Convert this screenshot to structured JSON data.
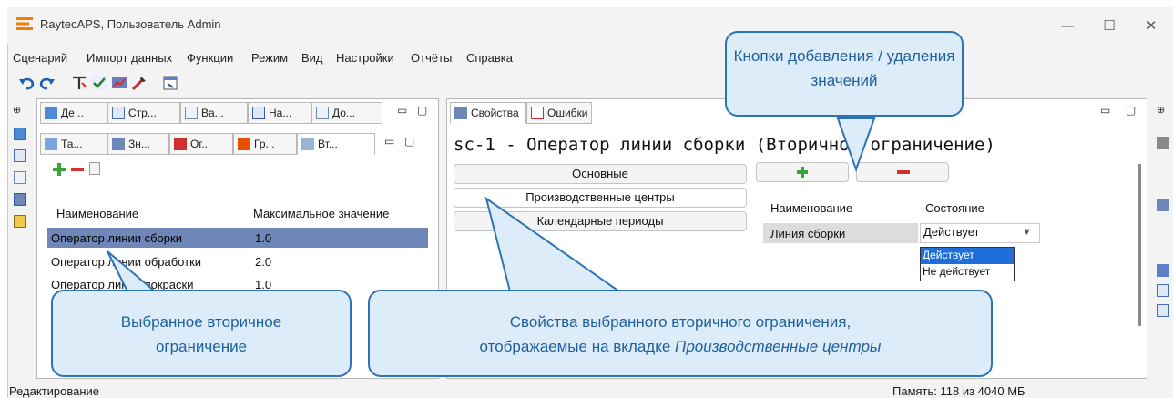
{
  "window": {
    "title": "RaytecAPS, Пользователь Admin"
  },
  "menu": [
    "Сценарий",
    "Импорт данных",
    "Функции",
    "Режим",
    "Вид",
    "Настройки",
    "Отчёты",
    "Справка"
  ],
  "left_tabs_row1": [
    "Де...",
    "Стр...",
    "Ва...",
    "На...",
    "До..."
  ],
  "left_tabs_row2": [
    "Та...",
    "Зн...",
    "Ог...",
    "Гр...",
    "Вт..."
  ],
  "left_grid": {
    "headers": [
      "Наименование",
      "Максимальное значение"
    ],
    "rows": [
      {
        "name": "Оператор линии сборки",
        "value": "1.0"
      },
      {
        "name": "Оператор линии обработки",
        "value": "2.0"
      },
      {
        "name": "Оператор линии покраски",
        "value": "1.0"
      }
    ]
  },
  "right_tabs": [
    "Свойства",
    "Ошибки"
  ],
  "right_title": "sc-1 - Оператор линии сборки (Вторичное ограничение)",
  "sections": [
    "Основные",
    "Производственные центры",
    "Календарные периоды"
  ],
  "right_grid": {
    "headers": [
      "Наименование",
      "Состояние"
    ],
    "rows": [
      {
        "name": "Линия сборки",
        "state": "Действует"
      }
    ],
    "dropdown_options": [
      "Действует",
      "Не действует"
    ]
  },
  "callouts": {
    "top": "Кнопки добавления / удаления значений",
    "left": "Выбранное вторичное ограничение",
    "bottom_line1": "Свойства выбранного вторичного ограничения,",
    "bottom_line2_prefix": "отображаемые на вкладке ",
    "bottom_line2_italic": "Производственные центры"
  },
  "status": {
    "left": "Редактирование",
    "right": "Память: 118 из 4040 МБ"
  },
  "colors": {
    "accent": "#2e74b5",
    "callout_fill": "#dcecf8",
    "selection": "#6f86b8",
    "add_green": "#3aa33a",
    "remove_red": "#d32f2f",
    "logo_orange": "#f57c00"
  }
}
